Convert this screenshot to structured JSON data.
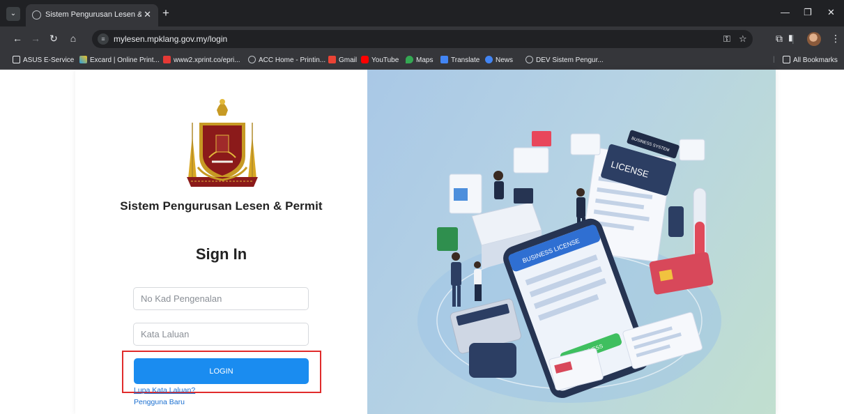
{
  "browser": {
    "tab_title": "Sistem Pengurusan Lesen & Per",
    "tab_close": "✕",
    "new_tab": "+",
    "url": "mylesen.mpklang.gov.my/login",
    "bookmarks": [
      {
        "label": "ASUS E-Service",
        "icon": "folder-icon"
      },
      {
        "label": "Excard | Online Print...",
        "icon": "excard-icon"
      },
      {
        "label": "www2.xprint.co/epri...",
        "icon": "xprint-icon"
      },
      {
        "label": "ACC Home - Printin...",
        "icon": "globe-icon"
      },
      {
        "label": "Gmail",
        "icon": "gmail-icon"
      },
      {
        "label": "YouTube",
        "icon": "youtube-icon"
      },
      {
        "label": "Maps",
        "icon": "maps-icon"
      },
      {
        "label": "Translate",
        "icon": "translate-icon"
      },
      {
        "label": "News",
        "icon": "news-icon"
      },
      {
        "label": "DEV Sistem Pengur...",
        "icon": "globe-icon"
      }
    ],
    "all_bookmarks": "All Bookmarks"
  },
  "login": {
    "system_title": "Sistem Pengurusan Lesen & Permit",
    "heading": "Sign In",
    "ic_placeholder": "No Kad Pengenalan",
    "password_placeholder": "Kata Laluan",
    "login_button": "LOGIN",
    "forgot_password": "Lupa Kata Laluan?",
    "new_user": "Pengguna Baru"
  },
  "illustration": {
    "license_card": "LICENSE",
    "business_system": "BUSINESS SYSTEM",
    "phone_banner": "BUSINESS LICENSE",
    "phone_button": "BUSINESS"
  },
  "colors": {
    "primary_button": "#1a8cf0",
    "highlight_box": "#e02b2b",
    "link": "#1a6fd0"
  }
}
